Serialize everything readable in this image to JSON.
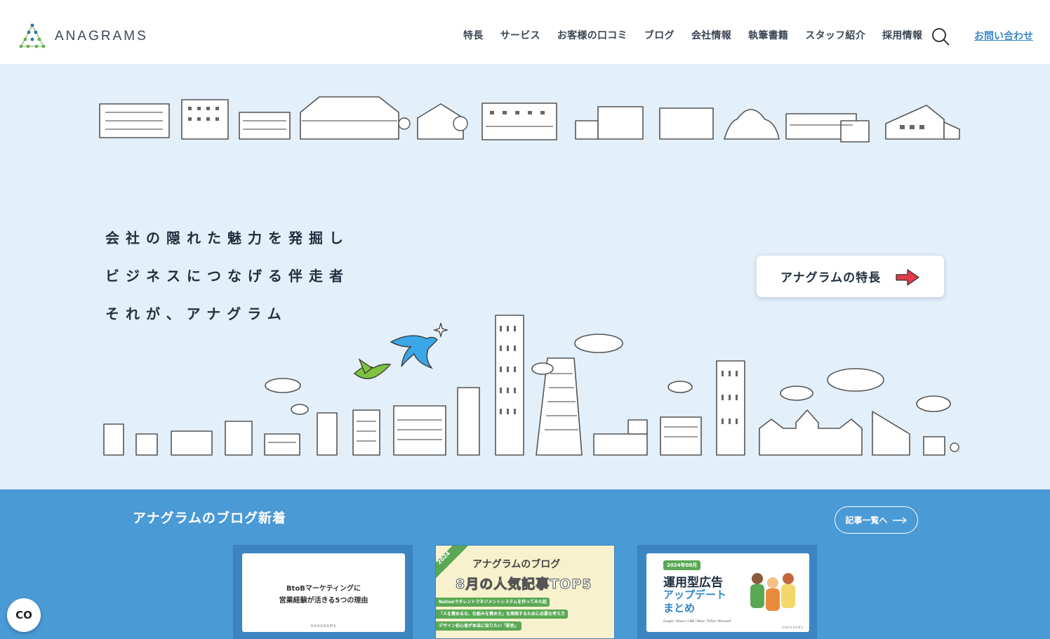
{
  "header": {
    "logo_text": "ANAGRAMS",
    "nav": [
      "特長",
      "サービス",
      "お客様の口コミ",
      "ブログ",
      "会社情報",
      "執筆書籍",
      "スタッフ紹介",
      "採用情報"
    ],
    "contact_label": "お問い合わせ"
  },
  "hero": {
    "tagline": [
      "会社の隠れた魅力を発掘し",
      "ビジネスにつなげる伴走者",
      "それが、アナグラム"
    ],
    "cta_label": "アナグラムの特長"
  },
  "blog": {
    "title": "アナグラムのブログ新着",
    "more_label": "記事一覧へ",
    "cards": [
      {
        "line1": "BtoBマーケティングに",
        "line2": "営業経験が活きる5つの理由",
        "brand": "ANAGRAMS"
      },
      {
        "year": "2024",
        "line1": "アナグラムのブログ",
        "line2": "8月の人気記事TOP5",
        "items": [
          "Notionでタレントマネジメントシステムを作ってみた話",
          "「人を責めるな、仕組みを責めろ」を実践するために必要な考え方",
          "デザイン初心者が本当に知りたい「配色」"
        ]
      },
      {
        "date": "2024年08月",
        "line1": "運用型広告",
        "line2": "アップデート",
        "line3": "まとめ",
        "sub": "Google / Yahoo! / LINE / Meta / TikTok / Microsoft",
        "brand": "ANAGRAMS"
      }
    ]
  },
  "cookie_label": "CO",
  "colors": {
    "hero_bg": "#e3eff9",
    "blog_bg": "#4a9ad6",
    "accent": "#3a86c8",
    "arrow": "#e23b4a"
  }
}
